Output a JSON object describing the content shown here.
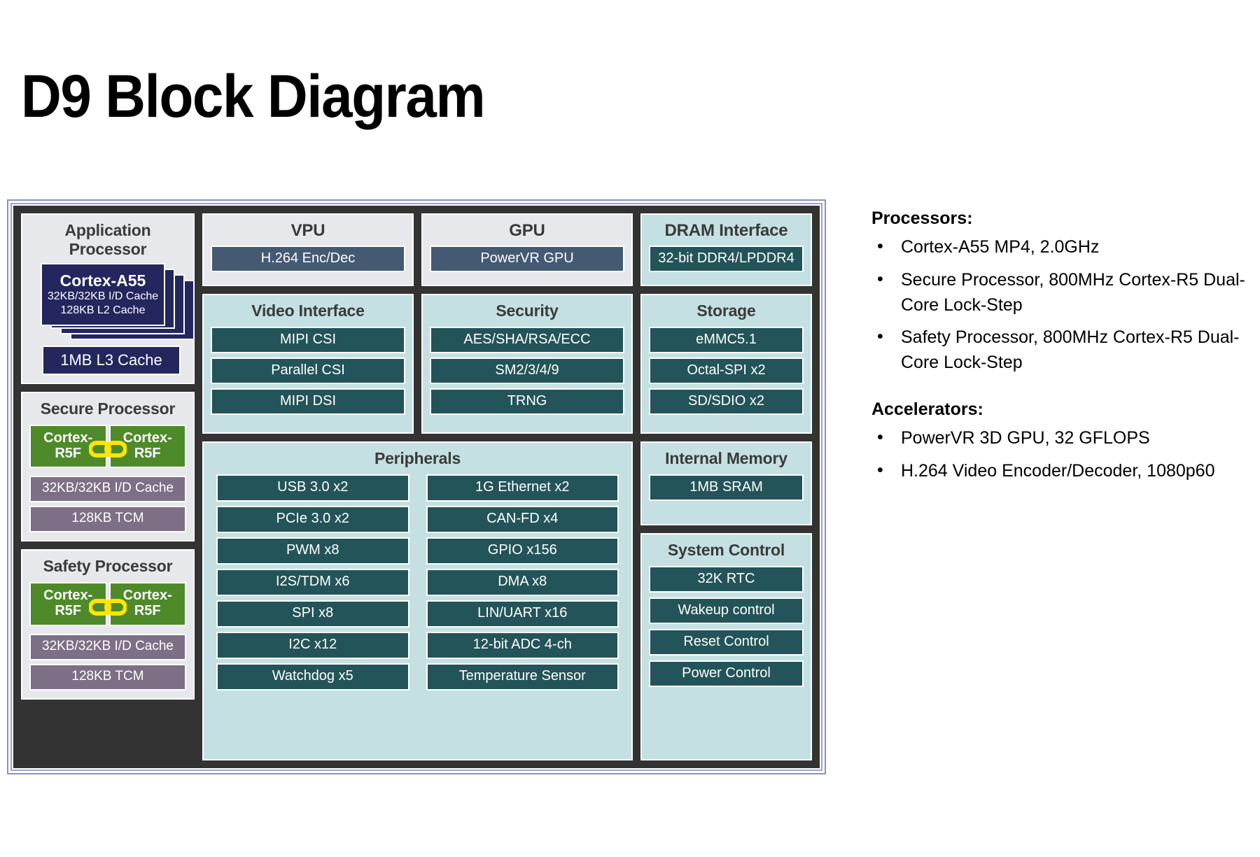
{
  "title": "D9 Block Diagram",
  "diagram": {
    "application_processor": {
      "title_line1": "Application",
      "title_line2": "Processor",
      "core_name": "Cortex-A55",
      "core_sub1": "32KB/32KB I/D Cache",
      "core_sub2": "128KB L2 Cache",
      "l3_cache": "1MB L3 Cache"
    },
    "secure_processor": {
      "title": "Secure Processor",
      "core_left_line1": "Cortex-",
      "core_left_line2": "R5F",
      "core_right_line1": "Cortex-",
      "core_right_line2": "R5F",
      "cache": "32KB/32KB I/D Cache",
      "tcm": "128KB TCM"
    },
    "safety_processor": {
      "title": "Safety Processor",
      "core_left_line1": "Cortex-",
      "core_left_line2": "R5F",
      "core_right_line1": "Cortex-",
      "core_right_line2": "R5F",
      "cache": "32KB/32KB  I/D Cache",
      "tcm": "128KB TCM"
    },
    "vpu": {
      "title": "VPU",
      "items": [
        "H.264 Enc/Dec"
      ]
    },
    "gpu": {
      "title": "GPU",
      "items": [
        "PowerVR GPU"
      ]
    },
    "dram_interface": {
      "title": "DRAM Interface",
      "items": [
        "32-bit DDR4/LPDDR4"
      ]
    },
    "video_interface": {
      "title": "Video Interface",
      "items": [
        "MIPI CSI",
        "Parallel CSI",
        "MIPI DSI"
      ]
    },
    "security": {
      "title": "Security",
      "items": [
        "AES/SHA/RSA/ECC",
        "SM2/3/4/9",
        "TRNG"
      ]
    },
    "storage": {
      "title": "Storage",
      "items": [
        "eMMC5.1",
        "Octal-SPI x2",
        "SD/SDIO x2"
      ]
    },
    "peripherals": {
      "title": "Peripherals",
      "column_left": [
        "USB 3.0 x2",
        "PCIe 3.0 x2",
        "PWM x8",
        "I2S/TDM x6",
        "SPI x8",
        "I2C x12",
        "Watchdog x5"
      ],
      "column_right": [
        "1G Ethernet x2",
        "CAN-FD x4",
        "GPIO x156",
        "DMA x8",
        "LIN/UART x16",
        "12-bit ADC 4-ch",
        "Temperature Sensor"
      ]
    },
    "internal_memory": {
      "title": "Internal Memory",
      "items": [
        "1MB SRAM"
      ]
    },
    "system_control": {
      "title": "System Control",
      "items": [
        "32K RTC",
        "Wakeup control",
        "Reset Control",
        "Power Control"
      ]
    }
  },
  "notes": {
    "processors_heading": "Processors:",
    "processors_items": [
      "Cortex-A55 MP4, 2.0GHz",
      "Secure Processor, 800MHz Cortex-R5 Dual-Core Lock-Step",
      "Safety Processor, 800MHz Cortex-R5 Dual-Core Lock-Step"
    ],
    "accelerators_heading": "Accelerators:",
    "accelerators_items": [
      "PowerVR 3D GPU, 32 GFLOPS",
      "H.264 Video Encoder/Decoder, 1080p60"
    ]
  },
  "colors": {
    "frame_border": "#8d8fc4",
    "diagram_bg": "#333333",
    "panel_gray": "#e6e8ec",
    "panel_teal": "#c4e0e2",
    "chip_navy": "#23275e",
    "chip_slate": "#445a73",
    "chip_teal": "#235459",
    "chip_green": "#4e8a2a",
    "chip_mauve": "#7d6f86",
    "link_icon": "#ffe500"
  }
}
